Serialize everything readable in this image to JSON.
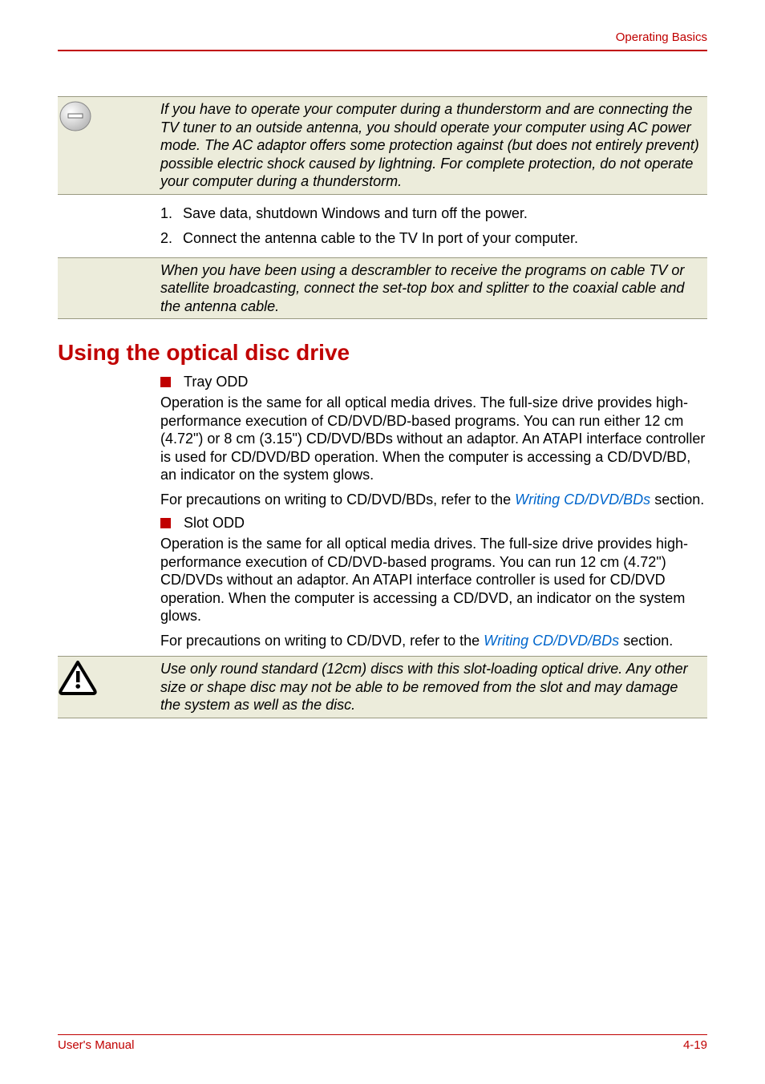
{
  "header": {
    "section_name": "Operating Basics"
  },
  "note1": {
    "text": "If you have to operate your computer during a thunderstorm and are connecting the TV tuner to an outside antenna, you should operate your computer using AC power mode. The AC adaptor offers some protection against (but does not entirely prevent) possible electric shock caused by lightning. For complete protection, do not operate your computer during a thunderstorm."
  },
  "steps": [
    {
      "num": "1.",
      "text": "Save data, shutdown Windows and turn off the power."
    },
    {
      "num": "2.",
      "text": "Connect the antenna cable to the TV In port of your computer."
    }
  ],
  "note2": {
    "text": "When you have been using a descrambler to receive the programs on cable TV or satellite broadcasting, connect the set-top box and splitter to the coaxial cable and the antenna cable."
  },
  "heading": "Using the optical disc drive",
  "bullets": {
    "tray": "Tray ODD",
    "slot": "Slot ODD"
  },
  "para1": "Operation is the same for all optical media drives. The full-size drive provides high-performance execution of CD/DVD/BD-based programs. You can run either 12 cm (4.72\") or 8 cm (3.15\") CD/DVD/BDs without an adaptor. An ATAPI interface controller is used for CD/DVD/BD operation. When the computer is accessing a CD/DVD/BD, an indicator on the system glows.",
  "para2_pre": "For precautions on writing to CD/DVD/BDs, refer to the ",
  "para2_link": "Writing CD/DVD/BDs",
  "para2_post": " section.",
  "para3": "Operation is the same for all optical media drives. The full-size drive provides high-performance execution of CD/DVD-based programs. You can run 12 cm (4.72\") CD/DVDs without an adaptor. An ATAPI interface controller is used for CD/DVD operation. When the computer is accessing a CD/DVD, an indicator on the system glows.",
  "para4_pre": "For precautions on writing to CD/DVD, refer to the ",
  "para4_link": "Writing CD/DVD/BDs",
  "para4_post": " section.",
  "caution": {
    "text": "Use only round standard (12cm) discs with this slot-loading optical drive. Any other size or shape disc may not be able to be removed from the slot and may damage the system as well as the disc."
  },
  "footer": {
    "left": "User's Manual",
    "right": "4-19"
  }
}
